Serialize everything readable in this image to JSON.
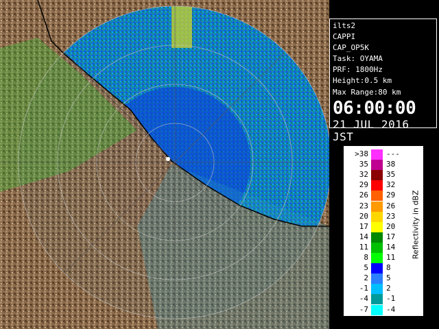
{
  "info": {
    "station": "ilts2",
    "product": "CAPPI",
    "product_id": "CAP_OP5K",
    "task": "Task: OYAMA",
    "prf": "PRF: 1800Hz",
    "height": "Height:0.5 km",
    "max_range": "Max Range:80 km",
    "time": "06:00:00",
    "date": "21 JUL 2016 JST"
  },
  "legend": {
    "title": "Reflectivity in dBZ",
    "rows": [
      {
        "lo": ">38",
        "hi": "---",
        "color": "#ff30ff"
      },
      {
        "lo": "35",
        "hi": "38",
        "color": "#c00090"
      },
      {
        "lo": "32",
        "hi": "35",
        "color": "#8b0000"
      },
      {
        "lo": "29",
        "hi": "32",
        "color": "#ff0000"
      },
      {
        "lo": "26",
        "hi": "29",
        "color": "#ff6000"
      },
      {
        "lo": "23",
        "hi": "26",
        "color": "#ff9a00"
      },
      {
        "lo": "20",
        "hi": "23",
        "color": "#ffd700"
      },
      {
        "lo": "17",
        "hi": "20",
        "color": "#ffff00"
      },
      {
        "lo": "14",
        "hi": "17",
        "color": "#008800"
      },
      {
        "lo": "11",
        "hi": "14",
        "color": "#00c000"
      },
      {
        "lo": "8",
        "hi": "11",
        "color": "#00ff00"
      },
      {
        "lo": "5",
        "hi": "8",
        "color": "#0000ff"
      },
      {
        "lo": "2",
        "hi": "5",
        "color": "#2a7fff"
      },
      {
        "lo": "-1",
        "hi": "2",
        "color": "#00bfff"
      },
      {
        "lo": "-4",
        "hi": "-1",
        "color": "#009a9a"
      },
      {
        "lo": "-7",
        "hi": "-4",
        "color": "#00ffff"
      }
    ]
  },
  "radar": {
    "background_color": "#0a3fd8",
    "land_color": "#8a6a4a",
    "range_ring_color": "#c8c8c8"
  }
}
